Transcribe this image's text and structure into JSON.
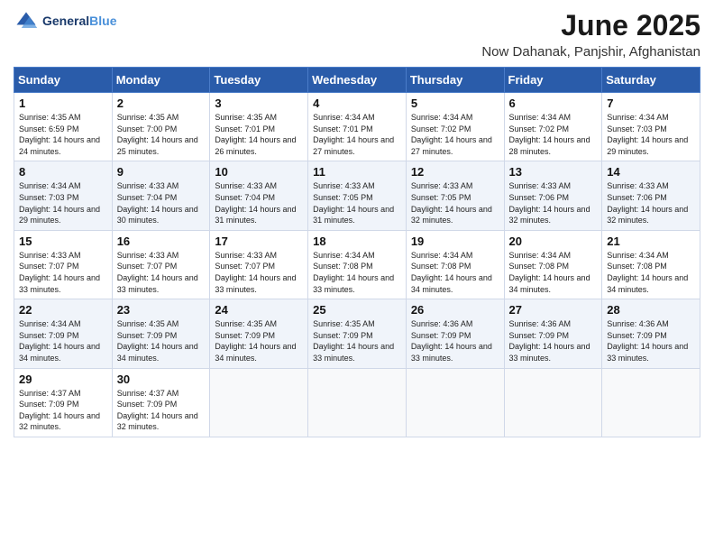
{
  "header": {
    "logo_line1": "General",
    "logo_line2": "Blue",
    "title": "June 2025",
    "subtitle": "Now Dahanak, Panjshir, Afghanistan"
  },
  "weekdays": [
    "Sunday",
    "Monday",
    "Tuesday",
    "Wednesday",
    "Thursday",
    "Friday",
    "Saturday"
  ],
  "weeks": [
    [
      {
        "day": "1",
        "sunrise": "4:35 AM",
        "sunset": "6:59 PM",
        "daylight": "14 hours and 24 minutes."
      },
      {
        "day": "2",
        "sunrise": "4:35 AM",
        "sunset": "7:00 PM",
        "daylight": "14 hours and 25 minutes."
      },
      {
        "day": "3",
        "sunrise": "4:35 AM",
        "sunset": "7:01 PM",
        "daylight": "14 hours and 26 minutes."
      },
      {
        "day": "4",
        "sunrise": "4:34 AM",
        "sunset": "7:01 PM",
        "daylight": "14 hours and 27 minutes."
      },
      {
        "day": "5",
        "sunrise": "4:34 AM",
        "sunset": "7:02 PM",
        "daylight": "14 hours and 27 minutes."
      },
      {
        "day": "6",
        "sunrise": "4:34 AM",
        "sunset": "7:02 PM",
        "daylight": "14 hours and 28 minutes."
      },
      {
        "day": "7",
        "sunrise": "4:34 AM",
        "sunset": "7:03 PM",
        "daylight": "14 hours and 29 minutes."
      }
    ],
    [
      {
        "day": "8",
        "sunrise": "4:34 AM",
        "sunset": "7:03 PM",
        "daylight": "14 hours and 29 minutes."
      },
      {
        "day": "9",
        "sunrise": "4:33 AM",
        "sunset": "7:04 PM",
        "daylight": "14 hours and 30 minutes."
      },
      {
        "day": "10",
        "sunrise": "4:33 AM",
        "sunset": "7:04 PM",
        "daylight": "14 hours and 31 minutes."
      },
      {
        "day": "11",
        "sunrise": "4:33 AM",
        "sunset": "7:05 PM",
        "daylight": "14 hours and 31 minutes."
      },
      {
        "day": "12",
        "sunrise": "4:33 AM",
        "sunset": "7:05 PM",
        "daylight": "14 hours and 32 minutes."
      },
      {
        "day": "13",
        "sunrise": "4:33 AM",
        "sunset": "7:06 PM",
        "daylight": "14 hours and 32 minutes."
      },
      {
        "day": "14",
        "sunrise": "4:33 AM",
        "sunset": "7:06 PM",
        "daylight": "14 hours and 32 minutes."
      }
    ],
    [
      {
        "day": "15",
        "sunrise": "4:33 AM",
        "sunset": "7:07 PM",
        "daylight": "14 hours and 33 minutes."
      },
      {
        "day": "16",
        "sunrise": "4:33 AM",
        "sunset": "7:07 PM",
        "daylight": "14 hours and 33 minutes."
      },
      {
        "day": "17",
        "sunrise": "4:33 AM",
        "sunset": "7:07 PM",
        "daylight": "14 hours and 33 minutes."
      },
      {
        "day": "18",
        "sunrise": "4:34 AM",
        "sunset": "7:08 PM",
        "daylight": "14 hours and 33 minutes."
      },
      {
        "day": "19",
        "sunrise": "4:34 AM",
        "sunset": "7:08 PM",
        "daylight": "14 hours and 34 minutes."
      },
      {
        "day": "20",
        "sunrise": "4:34 AM",
        "sunset": "7:08 PM",
        "daylight": "14 hours and 34 minutes."
      },
      {
        "day": "21",
        "sunrise": "4:34 AM",
        "sunset": "7:08 PM",
        "daylight": "14 hours and 34 minutes."
      }
    ],
    [
      {
        "day": "22",
        "sunrise": "4:34 AM",
        "sunset": "7:09 PM",
        "daylight": "14 hours and 34 minutes."
      },
      {
        "day": "23",
        "sunrise": "4:35 AM",
        "sunset": "7:09 PM",
        "daylight": "14 hours and 34 minutes."
      },
      {
        "day": "24",
        "sunrise": "4:35 AM",
        "sunset": "7:09 PM",
        "daylight": "14 hours and 34 minutes."
      },
      {
        "day": "25",
        "sunrise": "4:35 AM",
        "sunset": "7:09 PM",
        "daylight": "14 hours and 33 minutes."
      },
      {
        "day": "26",
        "sunrise": "4:36 AM",
        "sunset": "7:09 PM",
        "daylight": "14 hours and 33 minutes."
      },
      {
        "day": "27",
        "sunrise": "4:36 AM",
        "sunset": "7:09 PM",
        "daylight": "14 hours and 33 minutes."
      },
      {
        "day": "28",
        "sunrise": "4:36 AM",
        "sunset": "7:09 PM",
        "daylight": "14 hours and 33 minutes."
      }
    ],
    [
      {
        "day": "29",
        "sunrise": "4:37 AM",
        "sunset": "7:09 PM",
        "daylight": "14 hours and 32 minutes."
      },
      {
        "day": "30",
        "sunrise": "4:37 AM",
        "sunset": "7:09 PM",
        "daylight": "14 hours and 32 minutes."
      },
      {
        "day": "",
        "sunrise": "",
        "sunset": "",
        "daylight": ""
      },
      {
        "day": "",
        "sunrise": "",
        "sunset": "",
        "daylight": ""
      },
      {
        "day": "",
        "sunrise": "",
        "sunset": "",
        "daylight": ""
      },
      {
        "day": "",
        "sunrise": "",
        "sunset": "",
        "daylight": ""
      },
      {
        "day": "",
        "sunrise": "",
        "sunset": "",
        "daylight": ""
      }
    ]
  ]
}
